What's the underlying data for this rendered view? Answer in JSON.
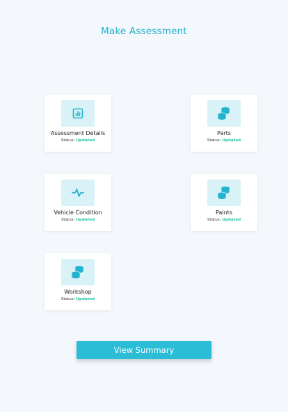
{
  "header": {
    "title": "Make Assessment"
  },
  "status_label": "Status:",
  "cards": [
    {
      "label": "Assessment Details",
      "status": "Updated",
      "icon": "bar-chart-icon"
    },
    {
      "label": "Parts",
      "status": "Updated",
      "icon": "coins-stack-icon"
    },
    {
      "label": "Vehicle Condition",
      "status": "Updated",
      "icon": "activity-pulse-icon"
    },
    {
      "label": "Paints",
      "status": "Updated",
      "icon": "coins-stack-icon"
    },
    {
      "label": "Workshop",
      "status": "Updated",
      "icon": "coins-stack-icon"
    }
  ],
  "actions": {
    "summary_label": "View Summary"
  },
  "colors": {
    "accent": "#2bbcd6",
    "title": "#1fb0cc",
    "status_value": "#27c2a3",
    "icon_bg": "#d9f2f7",
    "background": "#f4f7fb"
  }
}
